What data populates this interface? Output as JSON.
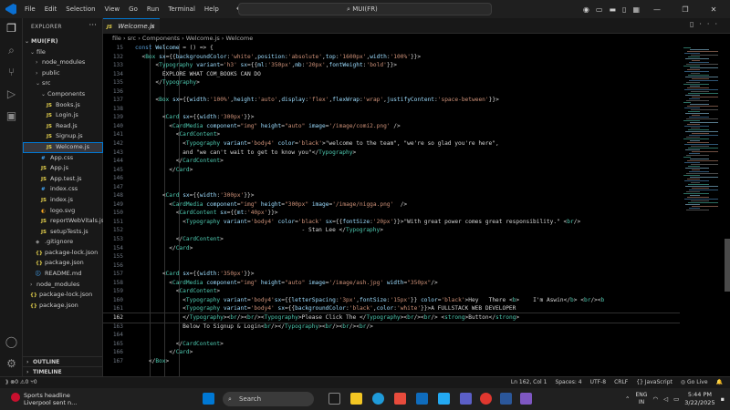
{
  "menu": [
    "File",
    "Edit",
    "Selection",
    "View",
    "Go",
    "Run",
    "Terminal",
    "Help"
  ],
  "search": {
    "text": "MUI(FR)"
  },
  "sidebar": {
    "title": "EXPLORER",
    "root": "MUI(FR)",
    "items": [
      {
        "label": "file",
        "level": 1,
        "kind": "folder-open"
      },
      {
        "label": "node_modules",
        "level": 2,
        "kind": "folder"
      },
      {
        "label": "public",
        "level": 2,
        "kind": "folder"
      },
      {
        "label": "src",
        "level": 2,
        "kind": "folder-open"
      },
      {
        "label": "Components",
        "level": 3,
        "kind": "folder-open"
      },
      {
        "label": "Books.js",
        "level": 4,
        "kind": "js"
      },
      {
        "label": "Login.js",
        "level": 4,
        "kind": "js"
      },
      {
        "label": "Read.js",
        "level": 4,
        "kind": "js"
      },
      {
        "label": "Signup.js",
        "level": 4,
        "kind": "js"
      },
      {
        "label": "Welcome.js",
        "level": 4,
        "kind": "js",
        "selected": true
      },
      {
        "label": "App.css",
        "level": 3,
        "kind": "css"
      },
      {
        "label": "App.js",
        "level": 3,
        "kind": "js"
      },
      {
        "label": "App.test.js",
        "level": 3,
        "kind": "js"
      },
      {
        "label": "index.css",
        "level": 3,
        "kind": "css"
      },
      {
        "label": "index.js",
        "level": 3,
        "kind": "js"
      },
      {
        "label": "logo.svg",
        "level": 3,
        "kind": "svg"
      },
      {
        "label": "reportWebVitals.js",
        "level": 3,
        "kind": "js"
      },
      {
        "label": "setupTests.js",
        "level": 3,
        "kind": "js"
      },
      {
        "label": ".gitignore",
        "level": 2,
        "kind": "git"
      },
      {
        "label": "package-lock.json",
        "level": 2,
        "kind": "json"
      },
      {
        "label": "package.json",
        "level": 2,
        "kind": "json"
      },
      {
        "label": "README.md",
        "level": 2,
        "kind": "md"
      },
      {
        "label": "node_modules",
        "level": 1,
        "kind": "folder"
      },
      {
        "label": "package-lock.json",
        "level": 1,
        "kind": "json"
      },
      {
        "label": "package.json",
        "level": 1,
        "kind": "json"
      }
    ],
    "outline": "OUTLINE",
    "timeline": "TIMELINE"
  },
  "tab": {
    "label": "Welcome.js",
    "close": "×"
  },
  "breadcrumb": {
    "parts": [
      "file",
      "src",
      "Components",
      "Welcome.js",
      "Welcome"
    ]
  },
  "editor": {
    "current_line": 162,
    "lines": [
      {
        "n": 15,
        "html": "<span class='k'>const</span> <span class='a'>Welcome</span> <span class='p'>= () =&gt; {</span>"
      },
      {
        "n": 132,
        "html": "  <span class='p'>&lt;</span><span class='t'>Box</span> <span class='a'>sx</span><span class='p'>={{</span><span class='a'>backgroundColor</span><span class='p'>:</span><span class='s'>'white'</span><span class='p'>,</span><span class='a'>position</span><span class='p'>:</span><span class='s'>'absolute'</span><span class='p'>,</span><span class='a'>top</span><span class='p'>:</span><span class='s'>'1600px'</span><span class='p'>,</span><span class='a'>width</span><span class='p'>:</span><span class='s'>'100%'</span><span class='p'>}}&gt;</span>"
      },
      {
        "n": 133,
        "html": "      <span class='p'>&lt;</span><span class='t'>Typography</span> <span class='a'>variant</span><span class='p'>=</span><span class='s'>'h3'</span> <span class='a'>sx</span><span class='p'>={{</span><span class='a'>ml</span><span class='p'>:</span><span class='s'>'350px'</span><span class='p'>,</span><span class='a'>mb</span><span class='p'>:</span><span class='s'>'20px'</span><span class='p'>,</span><span class='a'>fontWeight</span><span class='p'>:</span><span class='s'>'bold'</span><span class='p'>}}&gt;</span>"
      },
      {
        "n": 134,
        "html": "        <span class='w'>EXPLORE WHAT COM_BOOKS CAN DO</span>"
      },
      {
        "n": 135,
        "html": "      <span class='p'>&lt;/</span><span class='t'>Typography</span><span class='p'>&gt;</span>"
      },
      {
        "n": 136,
        "html": ""
      },
      {
        "n": 137,
        "html": "      <span class='p'>&lt;</span><span class='t'>Box</span> <span class='a'>sx</span><span class='p'>={{</span><span class='a'>width</span><span class='p'>:</span><span class='s'>'100%'</span><span class='p'>,</span><span class='a'>height</span><span class='p'>:</span><span class='s'>'auto'</span><span class='p'>,</span><span class='a'>display</span><span class='p'>:</span><span class='s'>'flex'</span><span class='p'>,</span><span class='a'>flexWrap</span><span class='p'>:</span><span class='s'>'wrap'</span><span class='p'>,</span><span class='a'>justifyContent</span><span class='p'>:</span><span class='s'>'space-between'</span><span class='p'>}}&gt;</span>"
      },
      {
        "n": 138,
        "html": ""
      },
      {
        "n": 139,
        "html": "        <span class='p'>&lt;</span><span class='t'>Card</span> <span class='a'>sx</span><span class='p'>={{</span><span class='a'>width</span><span class='p'>:</span><span class='s'>'300px'</span><span class='p'>}}&gt;</span>"
      },
      {
        "n": 140,
        "html": "          <span class='p'>&lt;</span><span class='t'>CardMedia</span> <span class='a'>component</span><span class='p'>=</span><span class='s'>\"img\"</span> <span class='a'>height</span><span class='p'>=</span><span class='s'>\"auto\"</span> <span class='a'>image</span><span class='p'>=</span><span class='s'>'/image/comi2.png'</span> <span class='p'>/&gt;</span>"
      },
      {
        "n": 141,
        "html": "            <span class='p'>&lt;</span><span class='t'>CardContent</span><span class='p'>&gt;</span>"
      },
      {
        "n": 142,
        "html": "              <span class='p'>&lt;</span><span class='t'>Typography</span> <span class='a'>variant</span><span class='p'>=</span><span class='s'>'body4'</span> <span class='a'>color</span><span class='p'>=</span><span class='s'>'black'</span><span class='p'>&gt;</span><span class='w'>\"welcome to the team\", \"we're so glad you're here\",</span>"
      },
      {
        "n": 143,
        "html": "              <span class='w'>and \"we can't wait to get to know you\"</span><span class='p'>&lt;/</span><span class='t'>Typography</span><span class='p'>&gt;</span>"
      },
      {
        "n": 144,
        "html": "            <span class='p'>&lt;/</span><span class='t'>CardContent</span><span class='p'>&gt;</span>"
      },
      {
        "n": 145,
        "html": "          <span class='p'>&lt;/</span><span class='t'>Card</span><span class='p'>&gt;</span>"
      },
      {
        "n": 146,
        "html": ""
      },
      {
        "n": 147,
        "html": ""
      },
      {
        "n": 148,
        "html": "        <span class='p'>&lt;</span><span class='t'>Card</span> <span class='a'>sx</span><span class='p'>={{</span><span class='a'>width</span><span class='p'>:</span><span class='s'>'300px'</span><span class='p'>}}&gt;</span>"
      },
      {
        "n": 149,
        "html": "          <span class='p'>&lt;</span><span class='t'>CardMedia</span> <span class='a'>component</span><span class='p'>=</span><span class='s'>\"img\"</span> <span class='a'>height</span><span class='p'>=</span><span class='s'>\"300px\"</span> <span class='a'>image</span><span class='p'>=</span><span class='s'>'/image/nigga.png'</span>  <span class='p'>/&gt;</span>"
      },
      {
        "n": 150,
        "html": "            <span class='p'>&lt;</span><span class='t'>CardContent</span> <span class='a'>sx</span><span class='p'>={{</span><span class='a'>mt</span><span class='p'>:</span><span class='s'>'40px'</span><span class='p'>}}&gt;</span>"
      },
      {
        "n": 151,
        "html": "              <span class='p'>&lt;</span><span class='t'>Typography</span> <span class='a'>variant</span><span class='p'>=</span><span class='s'>'body4'</span> <span class='a'>color</span><span class='p'>=</span><span class='s'>'black'</span> <span class='a'>sx</span><span class='p'>={{</span><span class='a'>fontSize</span><span class='p'>:</span><span class='s'>'20px'</span><span class='p'>}}&gt;</span><span class='w'>\"With great power comes great responsibility.\" </span><span class='p'>&lt;</span><span class='t'>br</span><span class='p'>/&gt;</span>"
      },
      {
        "n": 152,
        "html": "                                                 <span class='w'>- Stan Lee </span><span class='p'>&lt;/</span><span class='t'>Typography</span><span class='p'>&gt;</span>"
      },
      {
        "n": 153,
        "html": "            <span class='p'>&lt;/</span><span class='t'>CardContent</span><span class='p'>&gt;</span>"
      },
      {
        "n": 154,
        "html": "          <span class='p'>&lt;/</span><span class='t'>Card</span><span class='p'>&gt;</span>"
      },
      {
        "n": 155,
        "html": ""
      },
      {
        "n": 156,
        "html": ""
      },
      {
        "n": 157,
        "html": "        <span class='p'>&lt;</span><span class='t'>Card</span> <span class='a'>sx</span><span class='p'>={{</span><span class='a'>width</span><span class='p'>:</span><span class='s'>'350px'</span><span class='p'>}}&gt;</span>"
      },
      {
        "n": 158,
        "html": "          <span class='p'>&lt;</span><span class='t'>CardMedia</span> <span class='a'>component</span><span class='p'>=</span><span class='s'>\"img\"</span> <span class='a'>height</span><span class='p'>=</span><span class='s'>\"auto\"</span> <span class='a'>image</span><span class='p'>=</span><span class='s'>'/image/ash.jpg'</span> <span class='a'>width</span><span class='p'>=</span><span class='s'>\"350px\"</span><span class='p'>/&gt;</span>"
      },
      {
        "n": 159,
        "html": "            <span class='p'>&lt;</span><span class='t'>CardContent</span><span class='p'>&gt;</span>"
      },
      {
        "n": 160,
        "html": "              <span class='p'>&lt;</span><span class='t'>Typography</span> <span class='a'>variant</span><span class='p'>=</span><span class='s'>'body4'</span><span class='a'>sx</span><span class='p'>={{</span><span class='a'>letterSpacing</span><span class='p'>:</span><span class='s'>'3px'</span><span class='p'>,</span><span class='a'>fontSize</span><span class='p'>:</span><span class='s'>'15px'</span><span class='p'>}}</span> <span class='a'>color</span><span class='p'>=</span><span class='s'>'black'</span><span class='p'>&gt;</span><span class='w'>Hey   There </span><span class='p'>&lt;</span><span class='t'>b</span><span class='p'>&gt;</span>    <span class='w'>I'm Aswin</span><span class='p'>&lt;/</span><span class='t'>b</span><span class='p'>&gt;</span> <span class='p'>&lt;</span><span class='t'>br</span><span class='p'>/&gt;&lt;</span><span class='t'>b</span>"
      },
      {
        "n": 161,
        "html": "              <span class='p'>&lt;</span><span class='t'>Typography</span> <span class='a'>variant</span><span class='p'>=</span><span class='s'>'body4'</span> <span class='a'>sx</span><span class='p'>={{</span><span class='a'>backgroundColor</span><span class='p'>:</span><span class='s'>'black'</span><span class='p'>,</span><span class='a'>color</span><span class='p'>:</span><span class='s'>'white'</span><span class='p'>}}&gt;</span><span class='w'>A FULLSTACK WEB DEVELOPER</span>"
      },
      {
        "n": 162,
        "html": "              <span class='p'>&lt;/</span><span class='t'>Typography</span><span class='p'>&gt;&lt;</span><span class='t'>br</span><span class='p'>/&gt;&lt;</span><span class='t'>br</span><span class='p'>/&gt;&lt;</span><span class='t'>Typography</span><span class='p'>&gt;</span><span class='w'>Please Click The </span><span class='p'>&lt;/</span><span class='t'>Typography</span><span class='p'>&gt;&lt;</span><span class='t'>br</span><span class='p'>/&gt;&lt;</span><span class='t'>br</span><span class='p'>/&gt;</span> <span class='p'>&lt;</span><span class='t'>strong</span><span class='p'>&gt;</span><span class='w'>Button</span><span class='p'>&lt;/</span><span class='t'>strong</span><span class='p'>&gt;</span>"
      },
      {
        "n": 163,
        "html": "              <span class='w'>Below To Signup &amp; Login</span><span class='p'>&lt;</span><span class='t'>br</span><span class='p'>/&gt;&lt;/</span><span class='t'>Typography</span><span class='p'>&gt;&lt;</span><span class='t'>br</span><span class='p'>/&gt;&lt;</span><span class='t'>br</span><span class='p'>/&gt;&lt;</span><span class='t'>br</span><span class='p'>/&gt;</span>"
      },
      {
        "n": 164,
        "html": ""
      },
      {
        "n": 165,
        "html": "            <span class='p'>&lt;/</span><span class='t'>CardContent</span><span class='p'>&gt;</span>"
      },
      {
        "n": 166,
        "html": "          <span class='p'>&lt;/</span><span class='t'>Card</span><span class='p'>&gt;</span>"
      },
      {
        "n": 167,
        "html": "    <span class='p'>&lt;/</span><span class='t'>Box</span><span class='p'>&gt;</span>"
      }
    ]
  },
  "status": {
    "errors": "0",
    "warnings": "0",
    "ports": "0",
    "position": "Ln 162, Col 1",
    "spaces": "Spaces: 4",
    "encoding": "UTF-8",
    "eol": "CRLF",
    "language": "{} JavaScript",
    "golive": "Go Live"
  },
  "taskbar": {
    "weather_title": "Sports headline",
    "weather_sub": "Liverpool sent n...",
    "search": "Search",
    "lang1": "ENG",
    "lang2": "IN",
    "time": "5:44 PM",
    "date": "3/22/2025"
  },
  "colors": {
    "accent": "#0078d4",
    "keyword": "#569cd6",
    "tag": "#4ec9b0",
    "attr": "#9cdcfe",
    "string": "#ce9178"
  }
}
